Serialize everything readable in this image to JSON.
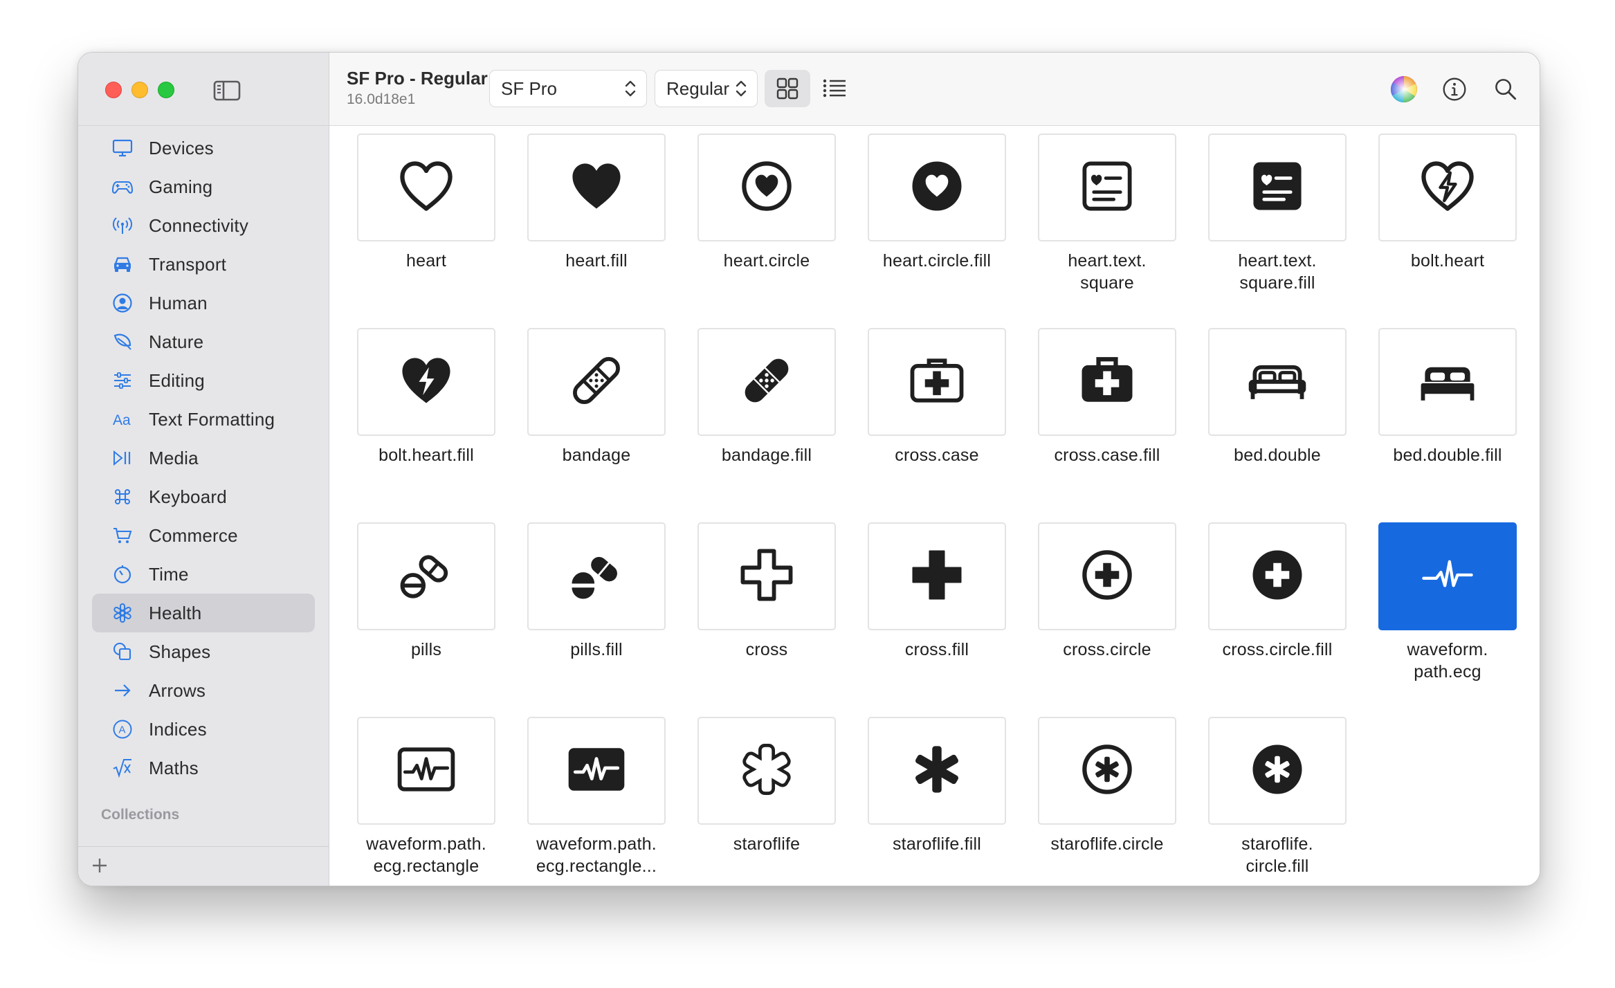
{
  "colors": {
    "accent": "#1769e0",
    "sidebar_bg": "#e6e6e9",
    "sidebar_icon": "#2f7be5"
  },
  "toolbar": {
    "title": "SF Pro - Regular",
    "subtitle": "16.0d18e1",
    "font_select": "SF Pro",
    "weight_select": "Regular"
  },
  "sidebar": {
    "items": [
      {
        "label": "Devices",
        "icon": "display-icon"
      },
      {
        "label": "Gaming",
        "icon": "gamecontroller-icon"
      },
      {
        "label": "Connectivity",
        "icon": "antenna-icon"
      },
      {
        "label": "Transport",
        "icon": "car-icon"
      },
      {
        "label": "Human",
        "icon": "person-circle-icon"
      },
      {
        "label": "Nature",
        "icon": "leaf-icon"
      },
      {
        "label": "Editing",
        "icon": "sliders-icon"
      },
      {
        "label": "Text Formatting",
        "icon": "textformat-icon"
      },
      {
        "label": "Media",
        "icon": "playpause-icon"
      },
      {
        "label": "Keyboard",
        "icon": "command-icon"
      },
      {
        "label": "Commerce",
        "icon": "cart-icon"
      },
      {
        "label": "Time",
        "icon": "timer-icon"
      },
      {
        "label": "Health",
        "icon": "staroflife-icon",
        "selected": true
      },
      {
        "label": "Shapes",
        "icon": "shapes-icon"
      },
      {
        "label": "Arrows",
        "icon": "arrow-right-icon"
      },
      {
        "label": "Indices",
        "icon": "a-circle-icon"
      },
      {
        "label": "Maths",
        "icon": "squareroot-icon"
      }
    ],
    "section_label": "Collections"
  },
  "symbols": [
    {
      "label": "heart",
      "icon": "heart"
    },
    {
      "label": "heart.fill",
      "icon": "heart.fill"
    },
    {
      "label": "heart.circle",
      "icon": "heart.circle"
    },
    {
      "label": "heart.circle.fill",
      "icon": "heart.circle.fill"
    },
    {
      "label": "heart.text.\nsquare",
      "icon": "heart.text.square"
    },
    {
      "label": "heart.text.\nsquare.fill",
      "icon": "heart.text.square.fill"
    },
    {
      "label": "bolt.heart",
      "icon": "bolt.heart"
    },
    {
      "label": "bolt.heart.fill",
      "icon": "bolt.heart.fill"
    },
    {
      "label": "bandage",
      "icon": "bandage"
    },
    {
      "label": "bandage.fill",
      "icon": "bandage.fill"
    },
    {
      "label": "cross.case",
      "icon": "cross.case"
    },
    {
      "label": "cross.case.fill",
      "icon": "cross.case.fill"
    },
    {
      "label": "bed.double",
      "icon": "bed.double"
    },
    {
      "label": "bed.double.fill",
      "icon": "bed.double.fill"
    },
    {
      "label": "pills",
      "icon": "pills"
    },
    {
      "label": "pills.fill",
      "icon": "pills.fill"
    },
    {
      "label": "cross",
      "icon": "cross"
    },
    {
      "label": "cross.fill",
      "icon": "cross.fill"
    },
    {
      "label": "cross.circle",
      "icon": "cross.circle"
    },
    {
      "label": "cross.circle.fill",
      "icon": "cross.circle.fill"
    },
    {
      "label": "waveform.\npath.ecg",
      "icon": "waveform.path.ecg",
      "selected": true
    },
    {
      "label": "waveform.path.\necg.rectangle",
      "icon": "waveform.path.ecg.rectangle"
    },
    {
      "label": "waveform.path.\necg.rectangle...",
      "icon": "waveform.path.ecg.rectangle.fill"
    },
    {
      "label": "staroflife",
      "icon": "staroflife"
    },
    {
      "label": "staroflife.fill",
      "icon": "staroflife.fill"
    },
    {
      "label": "staroflife.circle",
      "icon": "staroflife.circle"
    },
    {
      "label": "staroflife.\ncircle.fill",
      "icon": "staroflife.circle.fill"
    }
  ]
}
